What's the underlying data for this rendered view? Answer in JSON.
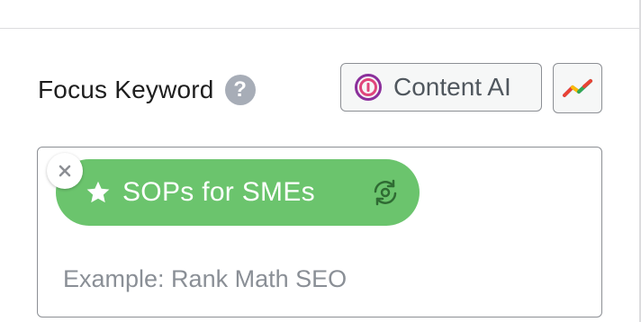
{
  "focus_keyword": {
    "label": "Focus Keyword",
    "help_icon_glyph": "?",
    "help_icon": "question-circle-icon",
    "content_ai_button": {
      "label": "Content AI",
      "icon": "content-ai-icon"
    },
    "trends_button": {
      "icon": "google-trends-icon"
    },
    "keywords": [
      {
        "text": "SOPs for SMEs",
        "primary": true,
        "icon": "star-icon",
        "action_icon": "rerank-icon",
        "remove_glyph": "×"
      }
    ],
    "input": {
      "value": "",
      "placeholder": "Example: Rank Math SEO"
    }
  },
  "colors": {
    "tag_green": "#6bc46d",
    "help_gray": "#a7adb7",
    "ai_purple": "#8b2f9b",
    "border": "#8c8f94"
  }
}
